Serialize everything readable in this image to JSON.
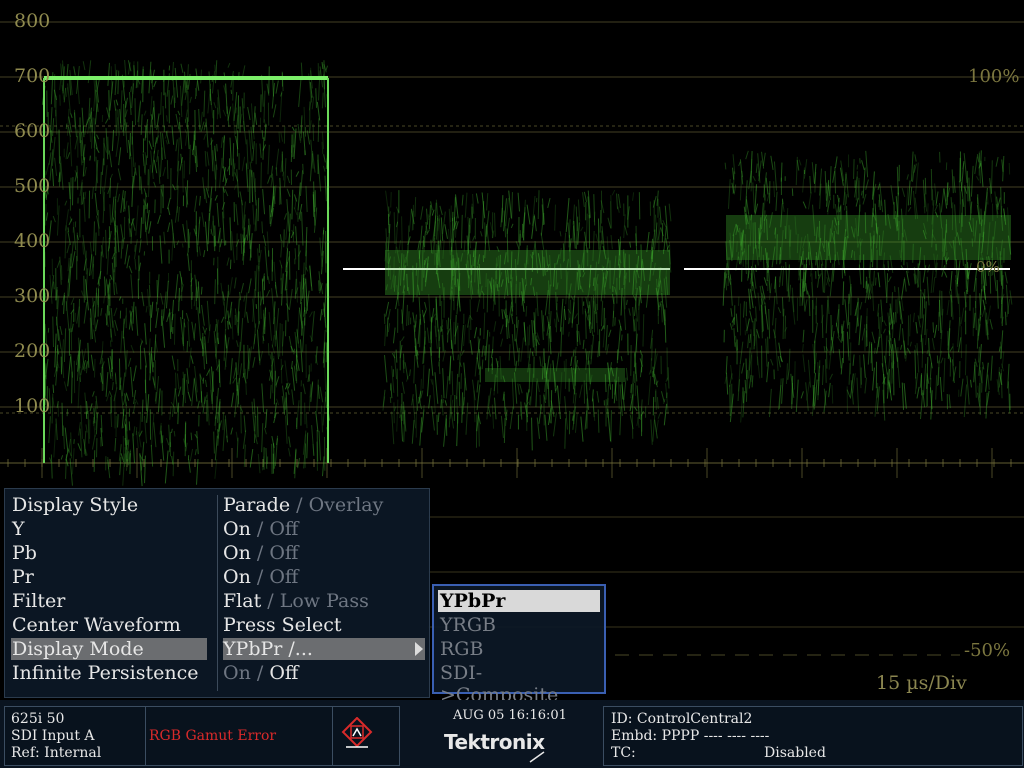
{
  "scale": {
    "y_axis_labels": [
      "800",
      "700",
      "600",
      "500",
      "400",
      "300",
      "200",
      "100"
    ],
    "right_label_top": "100%",
    "right_label_mid": "-50%",
    "right_label_mid_small": "0%",
    "time_per_div": "15 µs/Div"
  },
  "menu": {
    "items": [
      {
        "label": "Display Style",
        "value_active": "Parade",
        "value_other": "Overlay",
        "active_first": true
      },
      {
        "label": "Y",
        "value_active": "On",
        "value_other": "Off",
        "active_first": true
      },
      {
        "label": "Pb",
        "value_active": "On",
        "value_other": "Off",
        "active_first": true
      },
      {
        "label": "Pr",
        "value_active": "On",
        "value_other": "Off",
        "active_first": true
      },
      {
        "label": "Filter",
        "value_active": "Flat",
        "value_other": "Low Pass",
        "active_first": true
      },
      {
        "label": "Center Waveform",
        "value": "Press Select"
      },
      {
        "label": "Display Mode",
        "value": "YPbPr /...",
        "selected": true
      },
      {
        "label": "Infinite Persistence",
        "value_first": "On",
        "value_second": "Off",
        "active_first": false
      }
    ],
    "separator": "/"
  },
  "submenu": {
    "options": [
      "YPbPr",
      "YRGB",
      "RGB",
      "SDI->Composite"
    ],
    "selected_index": 0
  },
  "status": {
    "format": "625i 50",
    "input": "SDI Input A",
    "ref": "Ref: Internal",
    "alarm": "RGB Gamut Error",
    "datetime": "AUG 05 16:16:01",
    "brand": "Tektronix",
    "id": "ID: ControlCentral2",
    "embd": "Embd: PPPP ---- ---- ----",
    "tc_label": "TC:",
    "tc_value": "Disabled"
  },
  "colors": {
    "trace": "#3fae2f",
    "graticule": "#7b763f",
    "alarm": "#d92a2a",
    "menu_bg": "#0c1826",
    "highlight": "#6b6d70"
  },
  "icons": [
    "alarm-warning-icon",
    "submenu-arrow-icon"
  ]
}
